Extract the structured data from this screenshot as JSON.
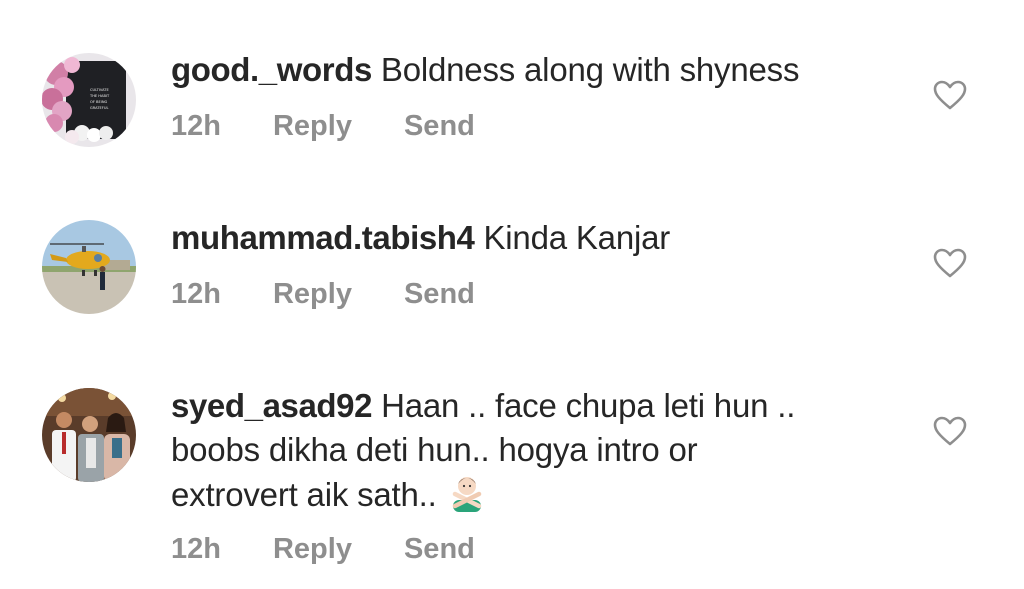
{
  "comments": [
    {
      "username": "good._words",
      "text": "Boldness along with shyness",
      "time": "12h",
      "reply_label": "Reply",
      "send_label": "Send",
      "avatar": {
        "poster_lines": [
          "CULTIVATE",
          "THE HABIT",
          "OF BEING",
          "GRATEFUL"
        ]
      }
    },
    {
      "username": "muhammad.tabish4",
      "text": "Kinda Kanjar",
      "time": "12h",
      "reply_label": "Reply",
      "send_label": "Send"
    },
    {
      "username": "syed_asad92",
      "text_lines": [
        "Haan .. face chupa leti hun ..",
        "boobs dikha deti hun.. hogya intro or",
        "extrovert aik sath.."
      ],
      "emoji": "person-gesturing-no",
      "time": "12h",
      "reply_label": "Reply",
      "send_label": "Send"
    }
  ],
  "colors": {
    "text": "#262626",
    "meta": "#8e8e8e",
    "heart_outline": "#8e8e8e"
  }
}
